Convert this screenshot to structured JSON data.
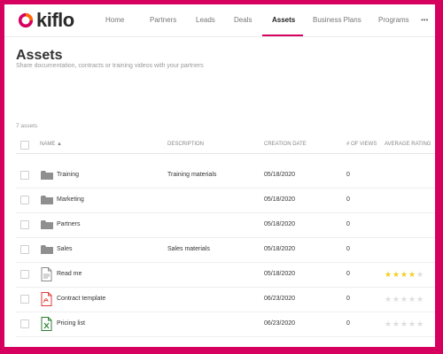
{
  "brand": {
    "name": "kiflo",
    "accent": "#d6005f"
  },
  "nav": [
    {
      "label": "Home"
    },
    {
      "label": "Partners"
    },
    {
      "label": "Leads"
    },
    {
      "label": "Deals"
    },
    {
      "label": "Assets"
    },
    {
      "label": "Business Plans"
    },
    {
      "label": "Programs"
    },
    {
      "label": "•••"
    }
  ],
  "page": {
    "title": "Assets",
    "subtitle": "Share documentation, contracts or training videos with your partners",
    "count": "7 assets"
  },
  "table": {
    "columns": [
      "NAME ▲",
      "DESCRIPTION",
      "CREATION DATE",
      "# OF VIEWS",
      "AVERAGE RATING"
    ],
    "rows": [
      {
        "name": "Training",
        "type": "folder",
        "description": "Training materials",
        "date": "05/18/2020",
        "views": "0",
        "rating": null
      },
      {
        "name": "Marketing",
        "type": "folder",
        "description": "",
        "date": "05/18/2020",
        "views": "0",
        "rating": null
      },
      {
        "name": "Partners",
        "type": "folder",
        "description": "",
        "date": "05/18/2020",
        "views": "0",
        "rating": null
      },
      {
        "name": "Sales",
        "type": "folder",
        "description": "Sales materials",
        "date": "05/18/2020",
        "views": "0",
        "rating": null
      },
      {
        "name": "Read me",
        "type": "document",
        "description": "",
        "date": "05/18/2020",
        "views": "0",
        "rating": 4
      },
      {
        "name": "Contract template",
        "type": "pdf",
        "description": "",
        "date": "06/23/2020",
        "views": "0",
        "rating": 0
      },
      {
        "name": "Pricing list",
        "type": "excel",
        "description": "",
        "date": "06/23/2020",
        "views": "0",
        "rating": 0
      }
    ]
  },
  "icons": {
    "folder": "folder-icon",
    "document": "document-icon",
    "pdf": "pdf-file-icon",
    "excel": "excel-file-icon"
  },
  "colors": {
    "star_filled": "#f2cf1f",
    "star_empty": "#dddddd",
    "folder": "#8f8f8f",
    "pdf": "#e53935",
    "excel": "#2e7d32"
  }
}
